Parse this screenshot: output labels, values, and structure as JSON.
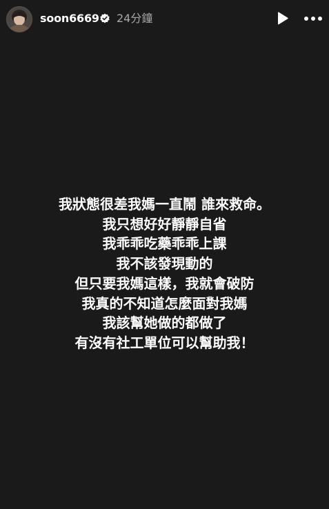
{
  "header": {
    "username": "soon6669",
    "verified": true,
    "timestamp": "24分鐘",
    "avatar_icon": "profile-avatar",
    "play_icon": "play-icon",
    "more_icon": "more-options-icon"
  },
  "story": {
    "background_color": "#1a1a1a",
    "text_color": "#ffffff",
    "lines": [
      "我狀態很差我媽一直鬧 誰來救命。",
      "我只想好好靜靜自省",
      "我乖乖吃藥乖乖上課",
      "我不該發現動的",
      "但只要我媽這樣，我就會破防",
      "我真的不知道怎麼面對我媽",
      "我該幫她做的都做了",
      "有沒有社工單位可以幫助我！"
    ]
  }
}
